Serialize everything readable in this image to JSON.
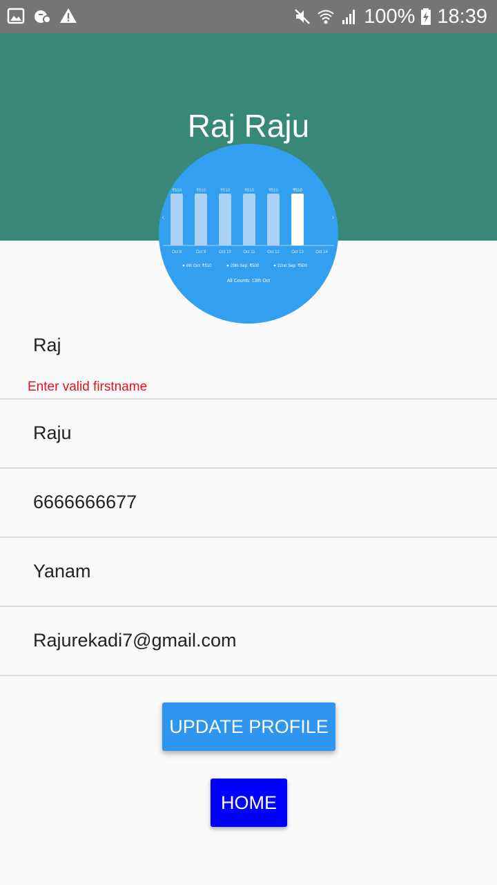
{
  "status_bar": {
    "battery_percent": "100%",
    "time": "18:39",
    "icons_left": [
      "gallery-icon",
      "mug-icon",
      "warning-icon"
    ],
    "icons_right": [
      "mute-icon",
      "wifi-icon",
      "signal-icon",
      "battery-charging-icon"
    ]
  },
  "header": {
    "title": "Raj Raju",
    "background_color": "#378876"
  },
  "avatar_chart": {
    "bars": [
      {
        "label": "Oct 8",
        "value_label": "₹510",
        "selected": false
      },
      {
        "label": "Oct 9",
        "value_label": "₹510",
        "selected": false
      },
      {
        "label": "Oct 10",
        "value_label": "₹510",
        "selected": false
      },
      {
        "label": "Oct 11",
        "value_label": "₹510",
        "selected": false
      },
      {
        "label": "Oct 12",
        "value_label": "₹510",
        "selected": false
      },
      {
        "label": "Oct 13",
        "value_label": "₹510",
        "selected": true
      }
    ],
    "extra_axis_label": "Oct 14",
    "legend": [
      "6th Oct: ₹510",
      "29th Sep: ₹500",
      "22nd Sep: ₹500"
    ],
    "footer": "All Counts: 13th Oct",
    "background_color": "#339ff0"
  },
  "form": {
    "first_name": "Raj",
    "first_name_error": "Enter valid firstname",
    "last_name": "Raju",
    "phone": "6666666677",
    "city": "Yanam",
    "email": "Rajurekadi7@gmail.com"
  },
  "buttons": {
    "update_label": "UPDATE PROFILE",
    "update_color": "#2e96ef",
    "home_label": "HOME",
    "home_color": "#0000ff"
  }
}
